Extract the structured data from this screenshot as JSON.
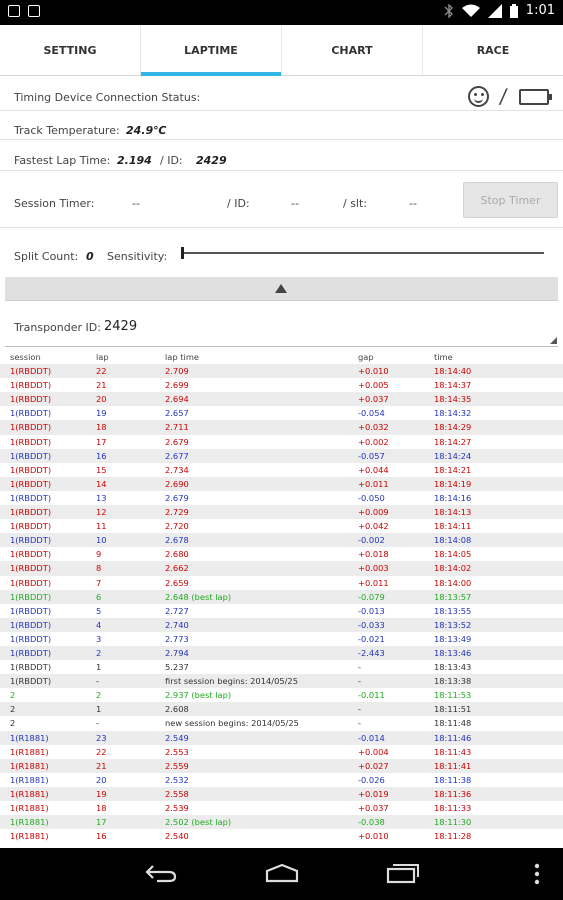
{
  "status_bar": {
    "time": "1:01"
  },
  "tabs": [
    {
      "label": "SETTING",
      "active": false
    },
    {
      "label": "LAPTIME",
      "active": true
    },
    {
      "label": "CHART",
      "active": false
    },
    {
      "label": "RACE",
      "active": false
    }
  ],
  "connection": {
    "label": "Timing Device Connection Status:"
  },
  "track": {
    "label": "Track Temperature:",
    "value": "24.9℃"
  },
  "fastest": {
    "label": "Fastest Lap Time:",
    "time": "2.194",
    "id_label": "/ ID:",
    "id": "2429"
  },
  "session_timer": {
    "label": "Session Timer:",
    "value": "--",
    "id_label": "/ ID:",
    "id": "--",
    "slt_label": "/ slt:",
    "slt": "--",
    "button": "Stop Timer"
  },
  "split": {
    "label": "Split Count:",
    "value": "0",
    "sensitivity_label": "Sensitivity:",
    "sensitivity_level": 0.0
  },
  "transponder": {
    "label": "Transponder ID:",
    "value": "2429"
  },
  "colors": {
    "red": "#cc0000",
    "blue": "#2233bb",
    "green": "#22aa22",
    "dark": "#333333",
    "accent": "#33b5e5"
  },
  "table": {
    "headers": [
      "session",
      "lap",
      "lap time",
      "gap",
      "time"
    ],
    "rows": [
      {
        "session": "1(RBDDT)",
        "lap": "22",
        "laptime": "2.709",
        "gap": "+0.010",
        "time": "18:14:40",
        "color": "red"
      },
      {
        "session": "1(RBDDT)",
        "lap": "21",
        "laptime": "2.699",
        "gap": "+0.005",
        "time": "18:14:37",
        "color": "red"
      },
      {
        "session": "1(RBDDT)",
        "lap": "20",
        "laptime": "2.694",
        "gap": "+0.037",
        "time": "18:14:35",
        "color": "red"
      },
      {
        "session": "1(RBDDT)",
        "lap": "19",
        "laptime": "2.657",
        "gap": "-0.054",
        "time": "18:14:32",
        "color": "blue"
      },
      {
        "session": "1(RBDDT)",
        "lap": "18",
        "laptime": "2.711",
        "gap": "+0.032",
        "time": "18:14:29",
        "color": "red"
      },
      {
        "session": "1(RBDDT)",
        "lap": "17",
        "laptime": "2.679",
        "gap": "+0.002",
        "time": "18:14:27",
        "color": "red"
      },
      {
        "session": "1(RBDDT)",
        "lap": "16",
        "laptime": "2.677",
        "gap": "-0.057",
        "time": "18:14:24",
        "color": "blue"
      },
      {
        "session": "1(RBDDT)",
        "lap": "15",
        "laptime": "2.734",
        "gap": "+0.044",
        "time": "18:14:21",
        "color": "red"
      },
      {
        "session": "1(RBDDT)",
        "lap": "14",
        "laptime": "2.690",
        "gap": "+0.011",
        "time": "18:14:19",
        "color": "red"
      },
      {
        "session": "1(RBDDT)",
        "lap": "13",
        "laptime": "2.679",
        "gap": "-0.050",
        "time": "18:14:16",
        "color": "blue"
      },
      {
        "session": "1(RBDDT)",
        "lap": "12",
        "laptime": "2.729",
        "gap": "+0.009",
        "time": "18:14:13",
        "color": "red"
      },
      {
        "session": "1(RBDDT)",
        "lap": "11",
        "laptime": "2.720",
        "gap": "+0.042",
        "time": "18:14:11",
        "color": "red"
      },
      {
        "session": "1(RBDDT)",
        "lap": "10",
        "laptime": "2.678",
        "gap": "-0.002",
        "time": "18:14:08",
        "color": "blue"
      },
      {
        "session": "1(RBDDT)",
        "lap": "9",
        "laptime": "2.680",
        "gap": "+0.018",
        "time": "18:14:05",
        "color": "red"
      },
      {
        "session": "1(RBDDT)",
        "lap": "8",
        "laptime": "2.662",
        "gap": "+0.003",
        "time": "18:14:02",
        "color": "red"
      },
      {
        "session": "1(RBDDT)",
        "lap": "7",
        "laptime": "2.659",
        "gap": "+0.011",
        "time": "18:14:00",
        "color": "red"
      },
      {
        "session": "1(RBDDT)",
        "lap": "6",
        "laptime": "2.648 (best lap)",
        "gap": "-0.079",
        "time": "18:13:57",
        "color": "green"
      },
      {
        "session": "1(RBDDT)",
        "lap": "5",
        "laptime": "2.727",
        "gap": "-0.013",
        "time": "18:13:55",
        "color": "blue"
      },
      {
        "session": "1(RBDDT)",
        "lap": "4",
        "laptime": "2.740",
        "gap": "-0.033",
        "time": "18:13:52",
        "color": "blue"
      },
      {
        "session": "1(RBDDT)",
        "lap": "3",
        "laptime": "2.773",
        "gap": "-0.021",
        "time": "18:13:49",
        "color": "blue"
      },
      {
        "session": "1(RBDDT)",
        "lap": "2",
        "laptime": "2.794",
        "gap": "-2.443",
        "time": "18:13:46",
        "color": "blue"
      },
      {
        "session": "1(RBDDT)",
        "lap": "1",
        "laptime": "5.237",
        "gap": "-",
        "time": "18:13:43",
        "color": "dark"
      },
      {
        "session": "1(RBDDT)",
        "lap": "-",
        "laptime": "first session begins: 2014/05/25",
        "gap": "-",
        "time": "18:13:38",
        "color": "dark"
      },
      {
        "session": "2",
        "lap": "2",
        "laptime": "2.937 (best lap)",
        "gap": "-0.011",
        "time": "18:11:53",
        "color": "green"
      },
      {
        "session": "2",
        "lap": "1",
        "laptime": "2.608",
        "gap": "-",
        "time": "18:11:51",
        "color": "dark"
      },
      {
        "session": "2",
        "lap": "-",
        "laptime": "new session begins: 2014/05/25",
        "gap": "-",
        "time": "18:11:48",
        "color": "dark"
      },
      {
        "session": "1(R1881)",
        "lap": "23",
        "laptime": "2.549",
        "gap": "-0.014",
        "time": "18:11:46",
        "color": "blue"
      },
      {
        "session": "1(R1881)",
        "lap": "22",
        "laptime": "2.553",
        "gap": "+0.004",
        "time": "18:11:43",
        "color": "red"
      },
      {
        "session": "1(R1881)",
        "lap": "21",
        "laptime": "2.559",
        "gap": "+0.027",
        "time": "18:11:41",
        "color": "red"
      },
      {
        "session": "1(R1881)",
        "lap": "20",
        "laptime": "2.532",
        "gap": "-0.026",
        "time": "18:11:38",
        "color": "blue"
      },
      {
        "session": "1(R1881)",
        "lap": "19",
        "laptime": "2.558",
        "gap": "+0.019",
        "time": "18:11:36",
        "color": "red"
      },
      {
        "session": "1(R1881)",
        "lap": "18",
        "laptime": "2.539",
        "gap": "+0.037",
        "time": "18:11:33",
        "color": "red"
      },
      {
        "session": "1(R1881)",
        "lap": "17",
        "laptime": "2.502 (best lap)",
        "gap": "-0.038",
        "time": "18:11:30",
        "color": "green"
      },
      {
        "session": "1(R1881)",
        "lap": "16",
        "laptime": "2.540",
        "gap": "+0.010",
        "time": "18:11:28",
        "color": "red"
      }
    ]
  }
}
